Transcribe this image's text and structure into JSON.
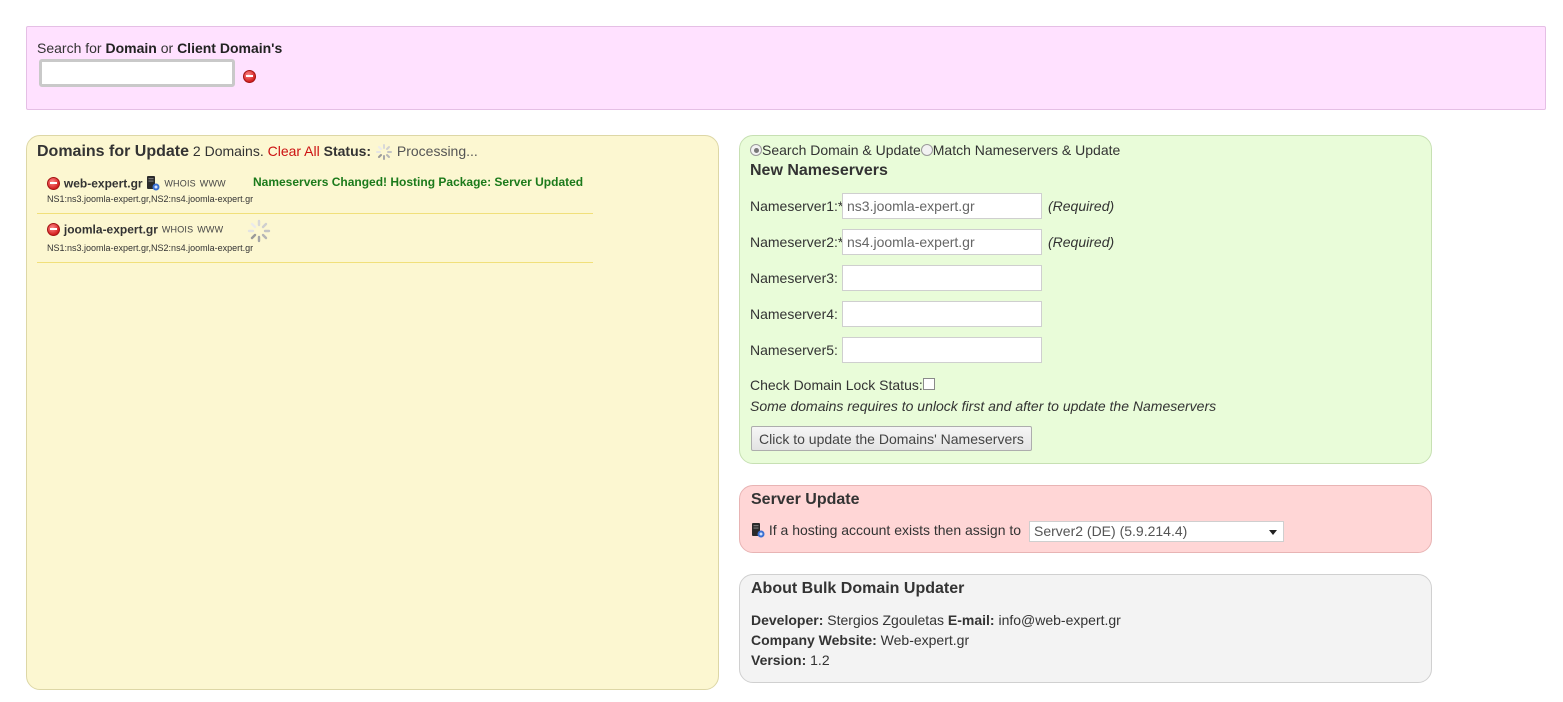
{
  "search": {
    "label_prefix": "Search for",
    "label_domain": "Domain",
    "label_or": "or",
    "label_client": "Client Domain's",
    "value": "",
    "placeholder": ""
  },
  "domains_panel": {
    "title": "Domains for Update",
    "count_text": "2 Domains.",
    "clear_all": "Clear All",
    "status_label": "Status:",
    "status_text": "Processing...",
    "items": [
      {
        "name": "web-expert.gr",
        "whois": "WHOIS",
        "www": "WWW",
        "result": "Nameservers Changed! Hosting Package: Server Updated",
        "ns": "NS1:ns3.joomla-expert.gr,NS2:ns4.joomla-expert.gr"
      },
      {
        "name": "joomla-expert.gr",
        "whois": "WHOIS",
        "www": "WWW",
        "result": "",
        "ns": "NS1:ns3.joomla-expert.gr,NS2:ns4.joomla-expert.gr"
      }
    ]
  },
  "nameservers_panel": {
    "mode_search": "Search Domain & Update",
    "mode_match": "Match Nameservers & Update",
    "title": "New Nameservers",
    "fields": [
      {
        "label": "Nameserver1:*",
        "value": "ns3.joomla-expert.gr",
        "note": "(Required)"
      },
      {
        "label": "Nameserver2:*",
        "value": "ns4.joomla-expert.gr",
        "note": "(Required)"
      },
      {
        "label": "Nameserver3:",
        "value": "",
        "note": ""
      },
      {
        "label": "Nameserver4:",
        "value": "",
        "note": ""
      },
      {
        "label": "Nameserver5:",
        "value": "",
        "note": ""
      }
    ],
    "lock_label": "Check Domain Lock Status:",
    "lock_note": "Some domains requires to unlock first and after to update the Nameservers",
    "update_button": "Click to update the Domains' Nameservers"
  },
  "server_panel": {
    "title": "Server Update",
    "label": "If a hosting account exists then assign to",
    "selected_server": "Server2 (DE) (5.9.214.4)"
  },
  "about_panel": {
    "title": "About Bulk Domain Updater",
    "developer_label": "Developer:",
    "developer_name": "Stergios Zgouletas",
    "email_label": "E-mail:",
    "email": "info@web-expert.gr",
    "website_label": "Company Website:",
    "website": "Web-expert.gr",
    "version_label": "Version:",
    "version": "1.2"
  },
  "colors": {
    "search_bg": "#ffe1ff",
    "domains_bg": "#fcf7d1",
    "nameservers_bg": "#e9fcd9",
    "server_bg": "#ffd6d6",
    "about_bg": "#f3f3f3",
    "success_text": "#1b7a1b",
    "clear_all_text": "#cc1111"
  }
}
